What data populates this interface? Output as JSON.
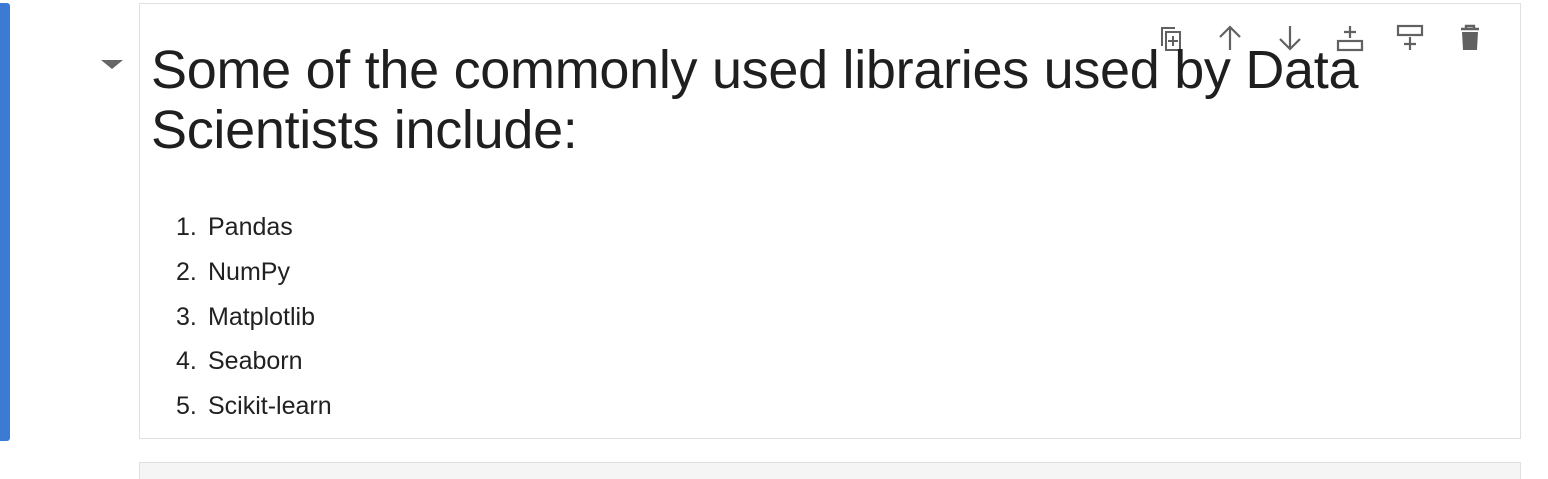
{
  "cell": {
    "heading": "Some of the commonly used libraries used by Data Scientists include:",
    "libraries": [
      {
        "num": "1.",
        "name": "Pandas"
      },
      {
        "num": "2.",
        "name": "NumPy"
      },
      {
        "num": "3.",
        "name": "Matplotlib"
      },
      {
        "num": "4.",
        "name": "Seaborn"
      },
      {
        "num": "5.",
        "name": "Scikit-learn"
      }
    ]
  },
  "toolbar": {
    "icons": [
      "duplicate-icon",
      "move-up-icon",
      "move-down-icon",
      "insert-below-icon",
      "insert-above-icon",
      "delete-icon"
    ]
  },
  "colors": {
    "active_bar": "#3b7bd4",
    "icon": "#616161",
    "cell_border": "#e0e0e0"
  }
}
